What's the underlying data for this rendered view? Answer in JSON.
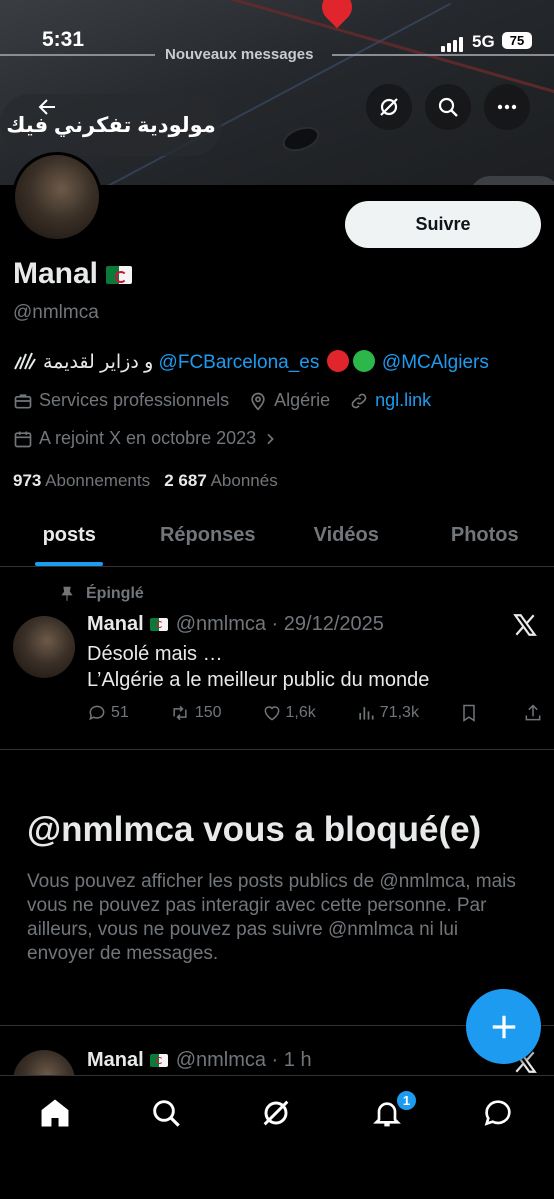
{
  "status_bar": {
    "time": "5:31",
    "banner_notice": "Nouveaux messages",
    "network": "5G",
    "battery": "75"
  },
  "header": {
    "song_pill": "مولودية تفكرني فيك"
  },
  "profile": {
    "follow_label": "Suivre",
    "name": "Manal",
    "handle": "@nmlmca",
    "bio_arabic": "و دزاير لقديمة",
    "bio_link1": "@FCBarcelona_es",
    "bio_link2": "@MCAlgiers",
    "category": "Services professionnels",
    "location": "Algérie",
    "website": "ngl.link",
    "joined": "A rejoint X en octobre 2023",
    "following_count": "973",
    "following_label": "Abonnements",
    "followers_count": "2 687",
    "followers_label": "Abonnés"
  },
  "tabs": [
    {
      "label": "posts"
    },
    {
      "label": "Réponses"
    },
    {
      "label": "Vidéos"
    },
    {
      "label": "Photos"
    }
  ],
  "pinned_post": {
    "pinned_label": "Épinglé",
    "author": "Manal",
    "handle_date": "@nmlmca · 29/12/2025",
    "line1": "Désolé mais …",
    "line2": "L’Algérie a le meilleur public du monde",
    "replies": "51",
    "reposts": "150",
    "likes": "1,6k",
    "views": "71,3k"
  },
  "blocked": {
    "title": "@nmlmca vous a bloqué(e)",
    "text": "Vous pouvez afficher les posts publics de @nmlmca, mais vous ne pouvez pas interagir avec cette personne. Par ailleurs, vous ne pouvez pas suivre @nmlmca ni lui envoyer de messages."
  },
  "second_post": {
    "author": "Manal",
    "handle_time": "@nmlmca · 1 h"
  },
  "bottom_nav": {
    "notification_badge": "1"
  },
  "colors": {
    "accent": "#1d9bf0",
    "background": "#000000",
    "muted": "#71767b"
  }
}
